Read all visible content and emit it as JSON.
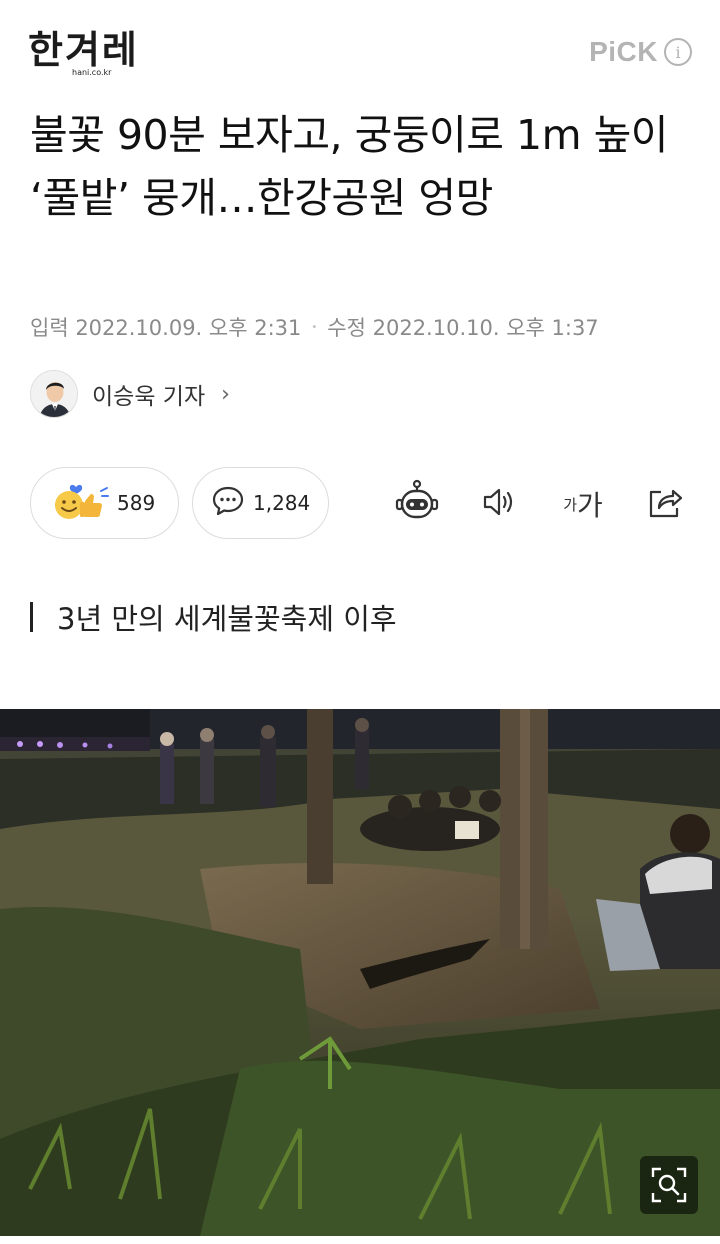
{
  "header": {
    "logo_main": "한겨레",
    "logo_sub": "hani.co.kr",
    "pick_label": "PiCK",
    "info_glyph": "i"
  },
  "article": {
    "title": "불꽃 90분 보자고, 궁둥이로 1m 높이 ‘풀밭’ 뭉개…한강공원 엉망",
    "published": "입력 2022.10.09. 오후 2:31",
    "separator": "•",
    "modified": "수정 2022.10.10. 오후 1:37",
    "author": "이승욱 기자",
    "author_chevron": "›",
    "subheading": "3년 만의 세계불꽃축제 이후"
  },
  "actions": {
    "reaction_count": "589",
    "comment_count": "1,284",
    "font_small": "가",
    "font_large": "가"
  },
  "icons": {
    "reaction": "smiley-thumbs-up-icon",
    "comment": "speech-bubble-icon",
    "robot": "robot-summary-icon",
    "audio": "speaker-icon",
    "font": "font-size-icon",
    "share": "share-icon",
    "zoom": "zoom-magnifier-icon"
  },
  "colors": {
    "pick_gray": "#b4b4b4",
    "meta_gray": "#8a8a8a",
    "reaction_yellow": "#f7c948",
    "reaction_blue": "#4a7cf0"
  }
}
